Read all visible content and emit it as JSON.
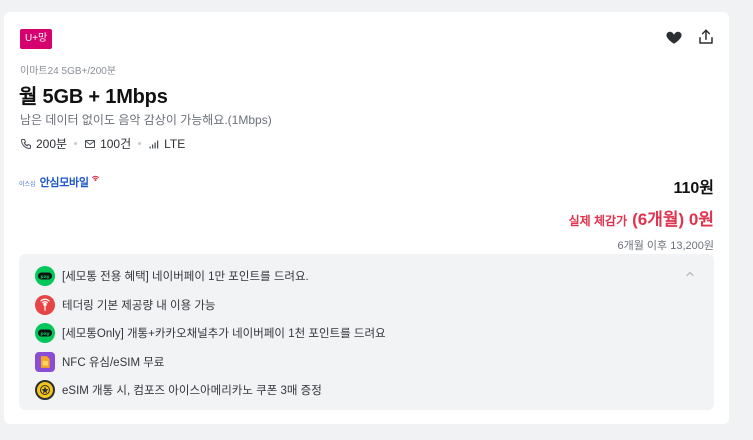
{
  "badge": "U+망",
  "plan": {
    "subtitle": "이마트24 5GB+/200분",
    "title": "월 5GB + 1Mbps",
    "description": "남은 데이터 없이도 음악 감상이 가능해요.(1Mbps)"
  },
  "specs": {
    "call": "200분",
    "sms": "100건",
    "network": "LTE"
  },
  "carrier": {
    "prefix": "이스심",
    "name": "안심모바일",
    "color": "#1d56c9"
  },
  "pricing": {
    "price": "110원",
    "real_label": "실제 체감가",
    "real_value": "(6개월) 0원",
    "after": "6개월 이후 13,200원"
  },
  "icons": {
    "like": "heart-icon",
    "share": "share-icon",
    "collapse": "chevron-up-icon"
  },
  "benefits": [
    {
      "text": "[세모통 전용 혜택] 네이버페이 1만 포인트를 드려요.",
      "icon": "naver-pay-icon",
      "color": "#03c75a"
    },
    {
      "text": "테더링 기본 제공량 내 이용 가능",
      "icon": "tethering-icon",
      "color": "#e64545"
    },
    {
      "text": "[세모통Only] 개통+카카오채널추가 네이버페이 1천 포인트를 드려요",
      "icon": "naver-pay-icon",
      "color": "#03c75a"
    },
    {
      "text": "NFC 유심/eSIM 무료",
      "icon": "sim-card-icon",
      "color": "#8a4dd6"
    },
    {
      "text": "eSIM 개통 시, 컴포즈 아이스아메리카노 쿠폰 3매 증정",
      "icon": "compose-coffee-icon",
      "color": "#f5c518"
    }
  ],
  "colors": {
    "badge": "#d6006e",
    "accent_red": "#e0344e",
    "card_bg": "#ffffff",
    "page_bg": "#f1f2f4"
  }
}
